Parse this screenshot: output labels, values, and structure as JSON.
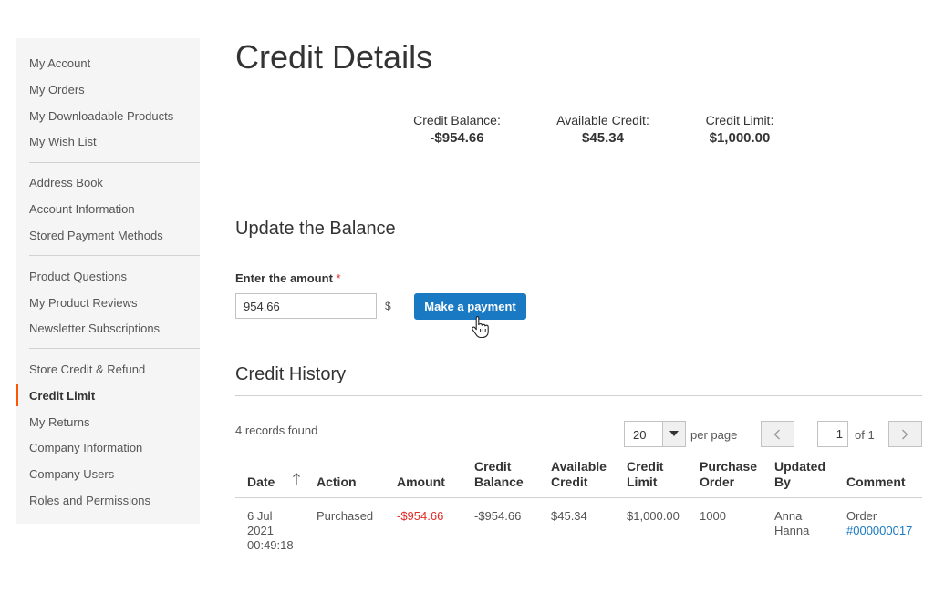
{
  "sidebar": {
    "items": [
      {
        "label": "My Account"
      },
      {
        "label": "My Orders"
      },
      {
        "label": "My Downloadable Products"
      },
      {
        "label": "My Wish List"
      },
      {
        "label": "Address Book"
      },
      {
        "label": "Account Information"
      },
      {
        "label": "Stored Payment Methods"
      },
      {
        "label": "Product Questions"
      },
      {
        "label": "My Product Reviews"
      },
      {
        "label": "Newsletter Subscriptions"
      },
      {
        "label": "Store Credit & Refund"
      },
      {
        "label": "Credit Limit"
      },
      {
        "label": "My Returns"
      },
      {
        "label": "Company Information"
      },
      {
        "label": "Company Users"
      },
      {
        "label": "Roles and Permissions"
      }
    ],
    "active_item": "Credit Limit"
  },
  "page": {
    "title": "Credit Details"
  },
  "summary": {
    "balance_label": "Credit Balance:",
    "balance_value": "-$954.66",
    "available_label": "Available Credit:",
    "available_value": "$45.34",
    "limit_label": "Credit Limit:",
    "limit_value": "$1,000.00"
  },
  "update": {
    "title": "Update the Balance",
    "amount_label": "Enter the amount",
    "required_mark": "*",
    "amount_value": "954.66",
    "currency_symbol": "$",
    "pay_button": "Make a payment"
  },
  "history": {
    "title": "Credit History",
    "records_found": "4 records found",
    "per_page_value": "20",
    "per_page_label": "per page",
    "current_page": "1",
    "page_of": "of 1",
    "columns": {
      "date": "Date",
      "action": "Action",
      "amount": "Amount",
      "credit_balance_1": "Credit",
      "credit_balance_2": "Balance",
      "available_credit_1": "Available",
      "available_credit_2": "Credit",
      "credit_limit_1": "Credit",
      "credit_limit_2": "Limit",
      "purchase_order_1": "Purchase",
      "purchase_order_2": "Order",
      "updated_by_1": "Updated",
      "updated_by_2": "By",
      "comment": "Comment"
    },
    "rows": [
      {
        "date_1": "6 Jul",
        "date_2": "2021",
        "date_3": "00:49:18",
        "action": "Purchased",
        "amount": "-$954.66",
        "credit_balance": "-$954.66",
        "available_credit": "$45.34",
        "credit_limit": "$1,000.00",
        "purchase_order": "1000",
        "updated_by_1": "Anna",
        "updated_by_2": "Hanna",
        "comment_prefix": "Order",
        "comment_link": "#000000017"
      }
    ]
  },
  "colors": {
    "accent": "#1979c3",
    "active_bar": "#ff5501",
    "negative": "#e02b27",
    "sidebar_bg": "#f5f5f5"
  }
}
